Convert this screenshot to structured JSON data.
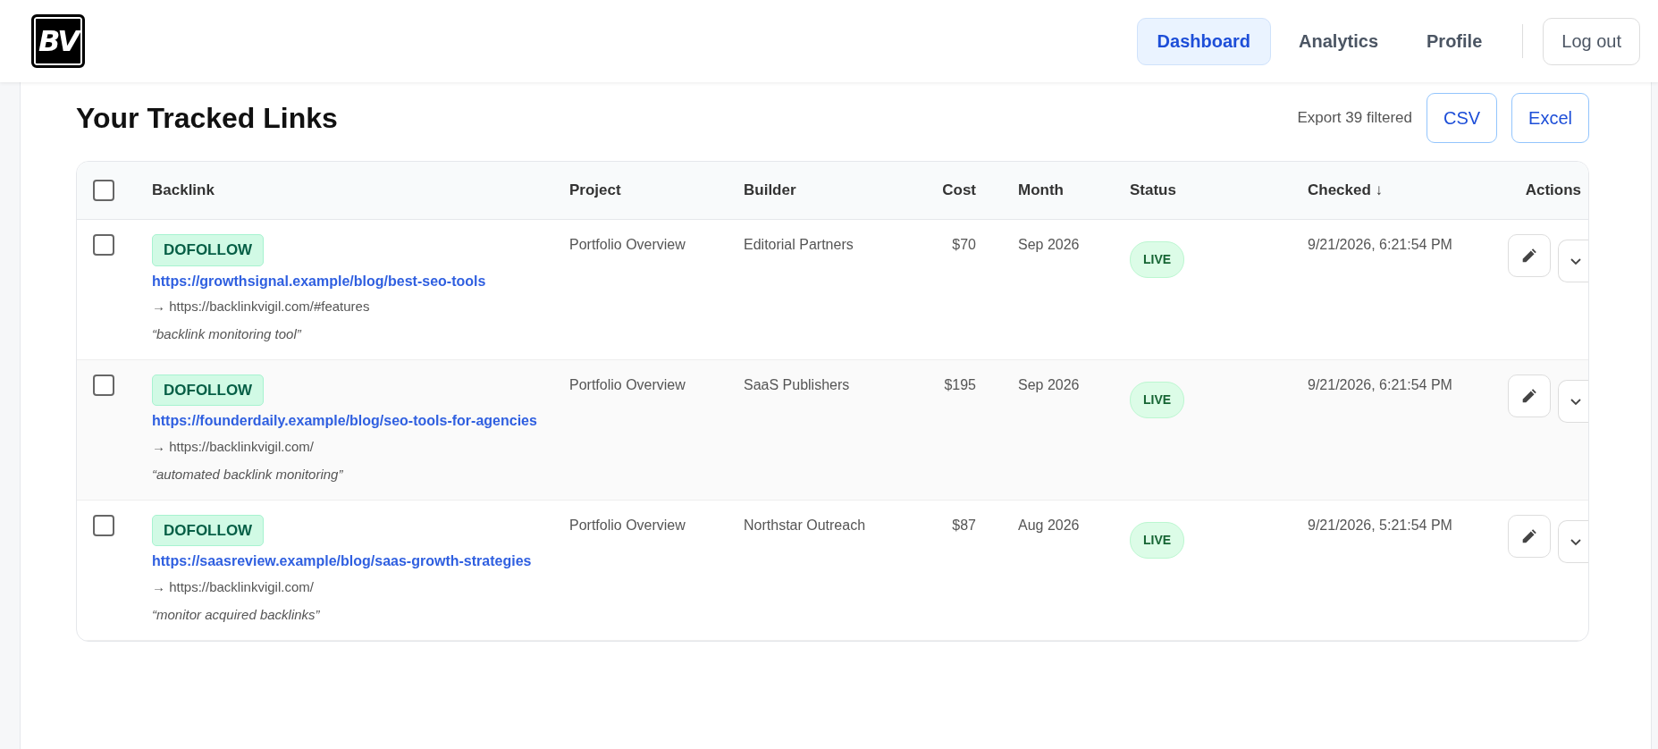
{
  "header": {
    "logo": "BV",
    "nav": [
      {
        "label": "Dashboard",
        "selected": true
      },
      {
        "label": "Analytics",
        "selected": false
      },
      {
        "label": "Profile",
        "selected": false
      }
    ],
    "logout": "Log out"
  },
  "title": "Your Tracked Links",
  "export": {
    "label": "Export 39 filtered",
    "buttons": [
      "CSV",
      "Excel"
    ]
  },
  "table": {
    "select_all": {
      "checked": false
    },
    "columns": [
      "Backlink",
      "Project",
      "Builder",
      "Cost",
      "Month",
      "Status",
      "Checked ↓",
      "Actions"
    ],
    "rows": [
      {
        "checked": false,
        "badge": "DOFOLLOW",
        "url": "https://growthsignal.example/blog/best-seo-tools",
        "target": "→ https://backlinkvigil.com/#features",
        "anchor": "“backlink monitoring tool”",
        "project": "Portfolio Overview",
        "builder": "Editorial Partners",
        "cost": "$70",
        "month": "Sep 2026",
        "status": "LIVE",
        "checked_at": "9/21/2026, 6:21:54 PM"
      },
      {
        "checked": false,
        "badge": "DOFOLLOW",
        "url": "https://founderdaily.example/blog/seo-tools-for-agencies",
        "target": "→ https://backlinkvigil.com/",
        "anchor": "“automated backlink monitoring”",
        "project": "Portfolio Overview",
        "builder": "SaaS Publishers",
        "cost": "$195",
        "month": "Sep 2026",
        "status": "LIVE",
        "checked_at": "9/21/2026, 6:21:54 PM"
      },
      {
        "checked": false,
        "badge": "DOFOLLOW",
        "url": "https://saasreview.example/blog/saas-growth-strategies",
        "target": "→ https://backlinkvigil.com/",
        "anchor": "“monitor acquired backlinks”",
        "project": "Portfolio Overview",
        "builder": "Northstar Outreach",
        "cost": "$87",
        "month": "Aug 2026",
        "status": "LIVE",
        "checked_at": "9/21/2026, 5:21:54 PM"
      }
    ]
  }
}
